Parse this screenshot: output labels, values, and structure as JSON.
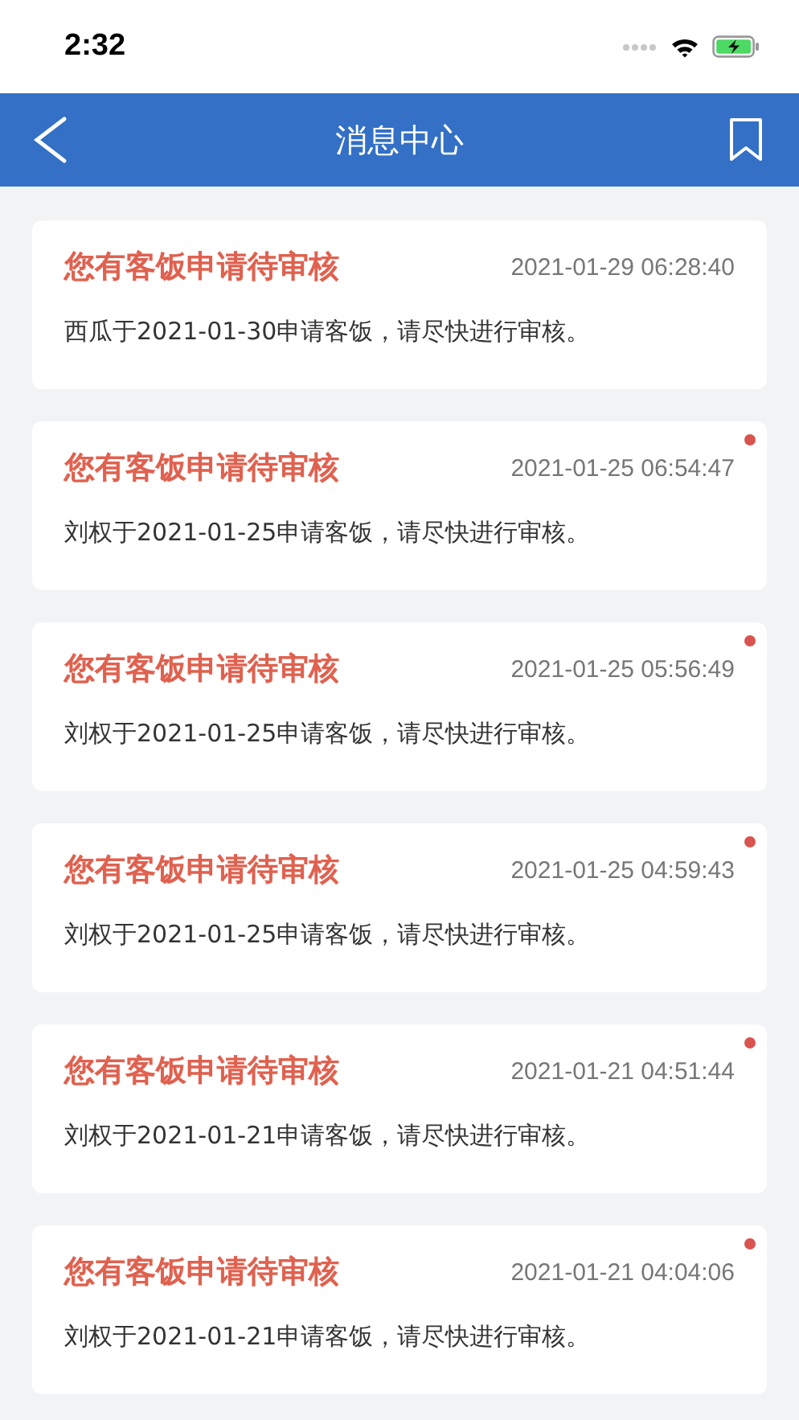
{
  "status_bar": {
    "time": "2:32"
  },
  "header": {
    "title": "消息中心"
  },
  "messages": [
    {
      "title": "您有客饭申请待审核",
      "time": "2021-01-29 06:28:40",
      "body": "西瓜于2021-01-30申请客饭，请尽快进行审核。",
      "unread": false
    },
    {
      "title": "您有客饭申请待审核",
      "time": "2021-01-25 06:54:47",
      "body": "刘权于2021-01-25申请客饭，请尽快进行审核。",
      "unread": true
    },
    {
      "title": "您有客饭申请待审核",
      "time": "2021-01-25 05:56:49",
      "body": "刘权于2021-01-25申请客饭，请尽快进行审核。",
      "unread": true
    },
    {
      "title": "您有客饭申请待审核",
      "time": "2021-01-25 04:59:43",
      "body": "刘权于2021-01-25申请客饭，请尽快进行审核。",
      "unread": true
    },
    {
      "title": "您有客饭申请待审核",
      "time": "2021-01-21 04:51:44",
      "body": "刘权于2021-01-21申请客饭，请尽快进行审核。",
      "unread": true
    },
    {
      "title": "您有客饭申请待审核",
      "time": "2021-01-21 04:04:06",
      "body": "刘权于2021-01-21申请客饭，请尽快进行审核。",
      "unread": true
    }
  ]
}
